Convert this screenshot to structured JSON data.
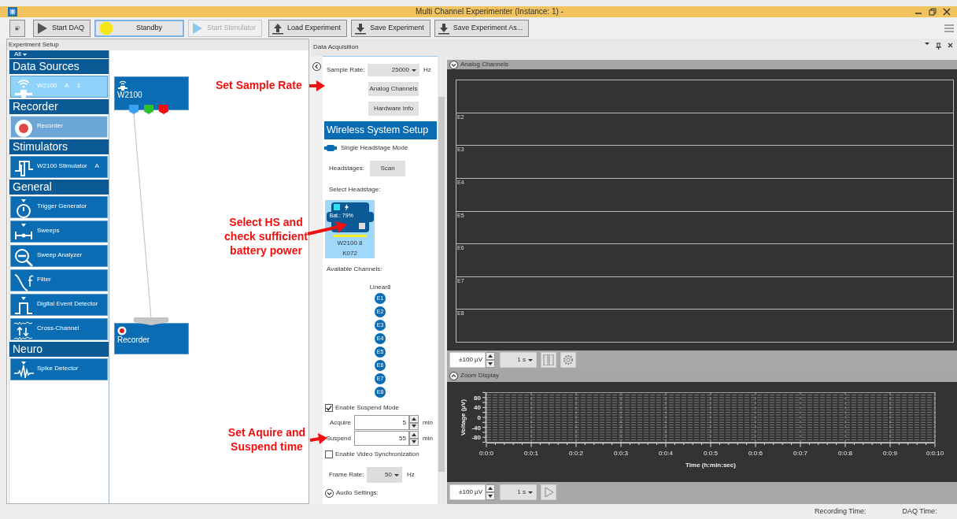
{
  "window": {
    "title": "Multi Channel Experimenter (Instance: 1) -"
  },
  "toolbar": {
    "buttons": [
      {
        "label": "Start DAQ",
        "kind": "play",
        "disabled": false,
        "pressed": false
      },
      {
        "label": "Standby",
        "kind": "standby",
        "disabled": false,
        "pressed": true
      },
      {
        "label": "Start Stimulator",
        "kind": "play",
        "disabled": true,
        "pressed": false
      },
      {
        "label": "Load Experiment",
        "kind": "load",
        "disabled": false,
        "pressed": false
      },
      {
        "label": "Save Experiment",
        "kind": "save",
        "disabled": false,
        "pressed": false
      },
      {
        "label": "Save Experiment As...",
        "kind": "save",
        "disabled": false,
        "pressed": false
      }
    ]
  },
  "experiment_setup": {
    "title": "Experiment Setup",
    "filter": "All",
    "categories": [
      {
        "name": "Data Sources",
        "items": [
          {
            "label": "W2100",
            "extra": [
              "A",
              "1"
            ],
            "kind": "wireless",
            "selected": true,
            "in_use": false
          }
        ]
      },
      {
        "name": "Recorder",
        "items": [
          {
            "label": "Recorder",
            "kind": "recorder",
            "selected": false,
            "in_use": true
          }
        ]
      },
      {
        "name": "Stimulators",
        "items": [
          {
            "label": "W2100 Stimulator",
            "extra": [
              "A"
            ],
            "kind": "stimulator",
            "selected": false,
            "in_use": false
          }
        ]
      },
      {
        "name": "General",
        "items": [
          {
            "label": "Trigger Generator",
            "kind": "trigger",
            "selected": false,
            "in_use": false
          },
          {
            "label": "Sweeps",
            "kind": "sweeps",
            "selected": false,
            "in_use": false
          },
          {
            "label": "Sweep Analyzer",
            "kind": "analyzer",
            "selected": false,
            "in_use": false
          },
          {
            "label": "Filter",
            "kind": "filter",
            "selected": false,
            "in_use": false
          },
          {
            "label": "Digital Event Detector",
            "kind": "digital",
            "selected": false,
            "in_use": false
          },
          {
            "label": "Cross-Channel",
            "kind": "cross",
            "selected": false,
            "in_use": false
          }
        ]
      },
      {
        "name": "Neuro",
        "items": [
          {
            "label": "Spike Detector",
            "kind": "spike",
            "selected": false,
            "in_use": false
          }
        ]
      }
    ],
    "nodes": [
      {
        "label": "W2100",
        "kind": "source",
        "ports": [
          {
            "color": "#3aa0f0"
          },
          {
            "color": "#2ec02e"
          },
          {
            "color": "#f01010"
          }
        ]
      },
      {
        "label": "Recorder",
        "kind": "recorder"
      }
    ]
  },
  "data_acquisition": {
    "title": "Data Acquisition",
    "sample_rate": {
      "label": "Sample Rate:",
      "value": "25000",
      "unit": "Hz"
    },
    "buttons": [
      "Analog Channels",
      "Hardware Info"
    ],
    "wireless_header": "Wireless System Setup",
    "mode": "Single Headstage Mode",
    "headstages": {
      "label": "Headstages:",
      "button": "Scan"
    },
    "select_label": "Select Headstage:",
    "headstage_tiles": [
      {
        "battery": "Bat.: 79%",
        "name": "W2100 8",
        "id": "K072",
        "selected": true
      }
    ],
    "channels_label": "Available Channels:",
    "layout": "Linear8",
    "electrodes": [
      "E1",
      "E2",
      "E3",
      "E4",
      "E5",
      "E6",
      "E7",
      "E8"
    ],
    "suspend_mode": {
      "label": "Enable Suspend Mode",
      "checked": true
    },
    "times": [
      {
        "label": "Acquire",
        "value": "5",
        "unit": "min"
      },
      {
        "label": "Suspend",
        "value": "55",
        "unit": "min"
      }
    ],
    "video_sync": {
      "label": "Enable Video Synchronization",
      "checked": false
    },
    "frame_rate": {
      "label": "Frame Rate:",
      "value": "50",
      "unit": "Hz"
    },
    "audio": {
      "label": "Audio Settings:"
    }
  },
  "analog_channels": {
    "title": "Analog Channels",
    "rows": [
      {},
      {
        "label": "E2"
      },
      {
        "label": "E3"
      },
      {
        "label": "E4"
      },
      {
        "label": "E5"
      },
      {
        "label": "E6"
      },
      {
        "label": "E7"
      },
      {
        "label": "E8"
      }
    ],
    "range": "±100 µV",
    "window": "1 s"
  },
  "zoom_display": {
    "title": "Zoom Display",
    "range": "±100 µV",
    "window": "1 s",
    "chart_data": {
      "type": "line",
      "xlabel": "Time (h:min:sec)",
      "ylabel": "Voltage (µV)",
      "ylim": [
        -100,
        100
      ],
      "categories": [
        "0:0:0",
        "0:0:1",
        "0:0:2",
        "0:0:3",
        "0:0:4",
        "0:0:5",
        "0:0:6",
        "0:0:7",
        "0:0:8",
        "0:0:9",
        "0:0:10"
      ],
      "yticks": [
        80,
        40,
        0,
        -40,
        -80
      ],
      "grid": true
    }
  },
  "status_bar": {
    "recording_time": "Recording Time:",
    "daq_time": "DAQ Time:"
  },
  "annotations": [
    {
      "text": "Set Sample Rate"
    },
    {
      "text": "Select HS and check sufficient battery power"
    },
    {
      "text": "Set Aquire and Suspend time"
    }
  ]
}
